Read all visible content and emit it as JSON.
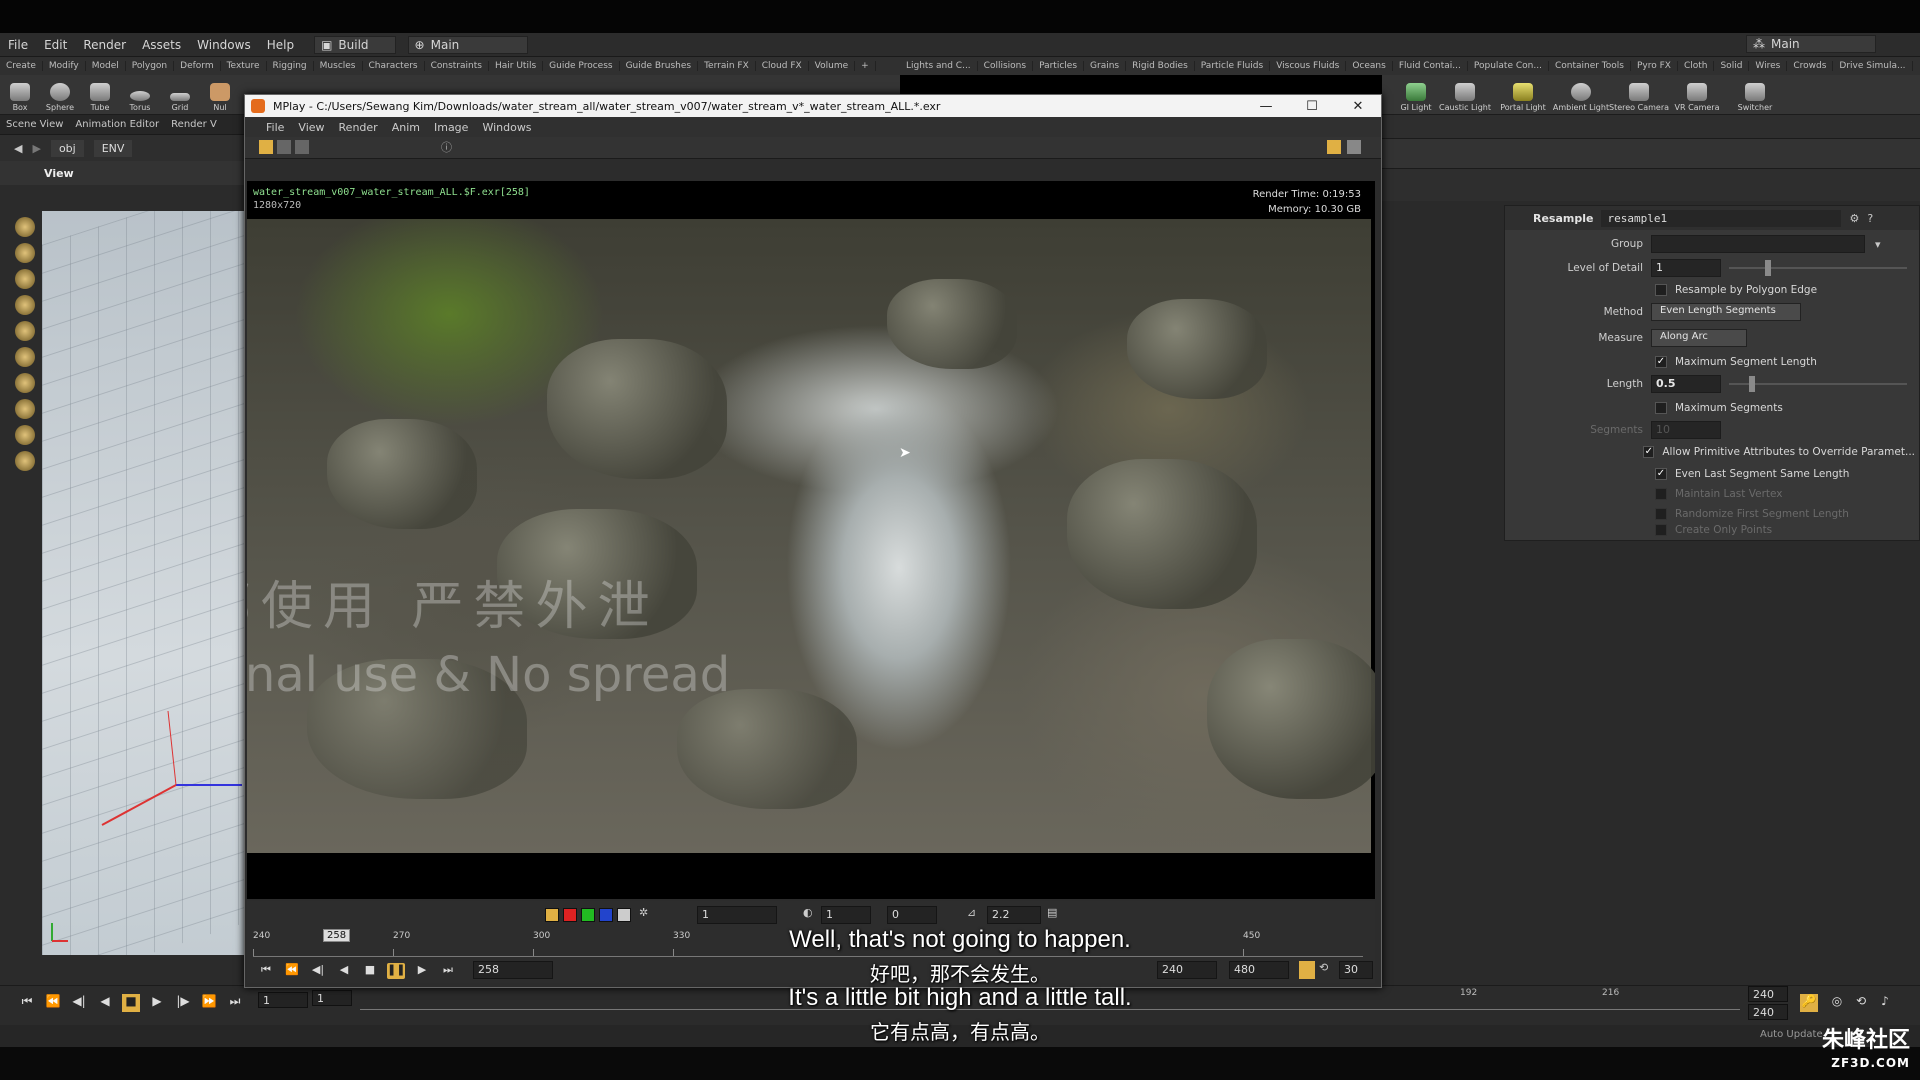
{
  "menubar": {
    "items": [
      "File",
      "Edit",
      "Render",
      "Assets",
      "Windows",
      "Help"
    ],
    "desktop_build": "Build",
    "desktop_main": "Main",
    "desktop_main_right": "Main"
  },
  "shelf": {
    "tabs_left": [
      "Create",
      "Modify",
      "Model",
      "Polygon",
      "Deform",
      "Texture",
      "Rigging",
      "Muscles",
      "Characters",
      "Constraints",
      "Hair Utils",
      "Guide Process",
      "Guide Brushes",
      "Terrain FX",
      "Cloud FX",
      "Volume"
    ],
    "tabs_right": [
      "Lights and C...",
      "Collisions",
      "Particles",
      "Grains",
      "Rigid Bodies",
      "Particle Fluids",
      "Viscous Fluids",
      "Oceans",
      "Fluid Contai...",
      "Populate Con...",
      "Container Tools",
      "Pyro FX",
      "Cloth",
      "Solid",
      "Wires",
      "Crowds",
      "Drive Simula..."
    ],
    "tools_left": [
      "Box",
      "Sphere",
      "Tube",
      "Torus",
      "Grid",
      "Nul"
    ],
    "tools_right": [
      "GI Light",
      "Caustic Light",
      "Portal Light",
      "Ambient Light",
      "Stereo Camera",
      "VR Camera",
      "Switcher"
    ]
  },
  "left_pane": {
    "tabs": [
      "Scene View",
      "Animation Editor",
      "Render V"
    ],
    "path_obj": "obj",
    "path_env": "ENV",
    "view_label": "View"
  },
  "mplay": {
    "title": "MPlay - C:/Users/Sewang Kim/Downloads/water_stream_all/water_stream_v007/water_stream_v*_water_stream_ALL.*.exr",
    "menu": [
      "File",
      "View",
      "Render",
      "Anim",
      "Image",
      "Windows"
    ],
    "sequence": "water_stream_v007_water_stream_ALL.$F.exr[258]",
    "resolution": "1280x720",
    "render_time": "Render Time: 0:19:53",
    "memory": "Memory:     10.30 GB",
    "watermark_cn": "内部使用 严禁外泄",
    "watermark_en": "Internal use & No spread",
    "controls": {
      "field_a": "1",
      "field_b": "1",
      "field_c": "0",
      "gamma": "2.2"
    },
    "ruler": {
      "labels": [
        "240",
        "270",
        "300",
        "330",
        "450"
      ],
      "current": "258"
    },
    "frame": "258",
    "range_start": "240",
    "range_end": "480",
    "fps": "30"
  },
  "params": {
    "node_type": "Resample",
    "node_name": "resample1",
    "group_label": "Group",
    "group_value": "",
    "lod_label": "Level of Detail",
    "lod_value": "1",
    "resample_by_edge": "Resample by Polygon Edge",
    "method_label": "Method",
    "method_value": "Even Length Segments",
    "measure_label": "Measure",
    "measure_value": "Along Arc",
    "max_seg_len": "Maximum Segment Length",
    "length_label": "Length",
    "length_value": "0.5",
    "max_segments": "Maximum Segments",
    "segments_label": "Segments",
    "segments_value": "10",
    "allow_prim": "Allow Primitive Attributes to Override Paramet...",
    "even_last": "Even Last Segment Same Length",
    "maintain_last": "Maintain Last Vertex",
    "randomize_first": "Randomize First Segment Length",
    "create_only": "Create Only Points"
  },
  "timeline": {
    "frame_a": "1",
    "frame_b": "1",
    "tick_192": "192",
    "tick_216": "216",
    "end_a": "240",
    "end_b": "240",
    "auto_update": "Auto Update"
  },
  "subtitles": {
    "line1_en": "Well, that's not going to happen.",
    "line1_zh": "好吧，那不会发生。",
    "line2_en": "It's a little bit high and a little tall.",
    "line2_zh": "它有点高，有点高。"
  },
  "logo": {
    "cn": "朱峰社区",
    "domain": "ZF3D.COM"
  }
}
